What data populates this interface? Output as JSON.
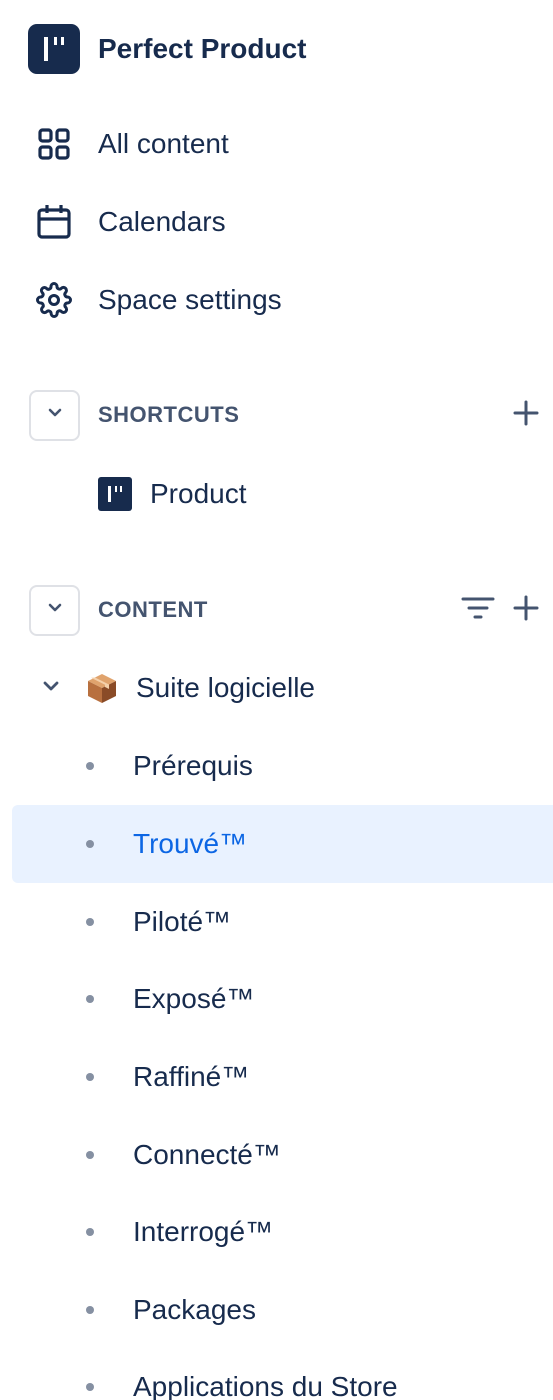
{
  "space": {
    "title": "Perfect Product"
  },
  "nav": [
    {
      "label": "All content",
      "icon": "grid-icon"
    },
    {
      "label": "Calendars",
      "icon": "calendar-icon"
    },
    {
      "label": "Space settings",
      "icon": "gear-icon"
    }
  ],
  "shortcuts": {
    "title": "SHORTCUTS",
    "items": [
      {
        "label": "Product",
        "icon": "space-logo-icon"
      }
    ]
  },
  "content": {
    "title": "CONTENT",
    "root": {
      "label": "Suite logicielle",
      "icon": "package-icon",
      "expanded": true
    },
    "children": [
      {
        "label": "Prérequis",
        "selected": false
      },
      {
        "label": "Trouvé™",
        "selected": true
      },
      {
        "label": "Piloté™",
        "selected": false
      },
      {
        "label": "Exposé™",
        "selected": false
      },
      {
        "label": "Raffiné™",
        "selected": false
      },
      {
        "label": "Connecté™",
        "selected": false
      },
      {
        "label": "Interrogé™",
        "selected": false
      },
      {
        "label": "Packages",
        "selected": false
      },
      {
        "label": "Applications du Store",
        "selected": false
      }
    ]
  },
  "colors": {
    "text": "#172b4d",
    "section_text": "#44546f",
    "selected_bg": "#e9f2ff",
    "selected_text": "#0c66e4",
    "bullet": "#8590a2"
  }
}
